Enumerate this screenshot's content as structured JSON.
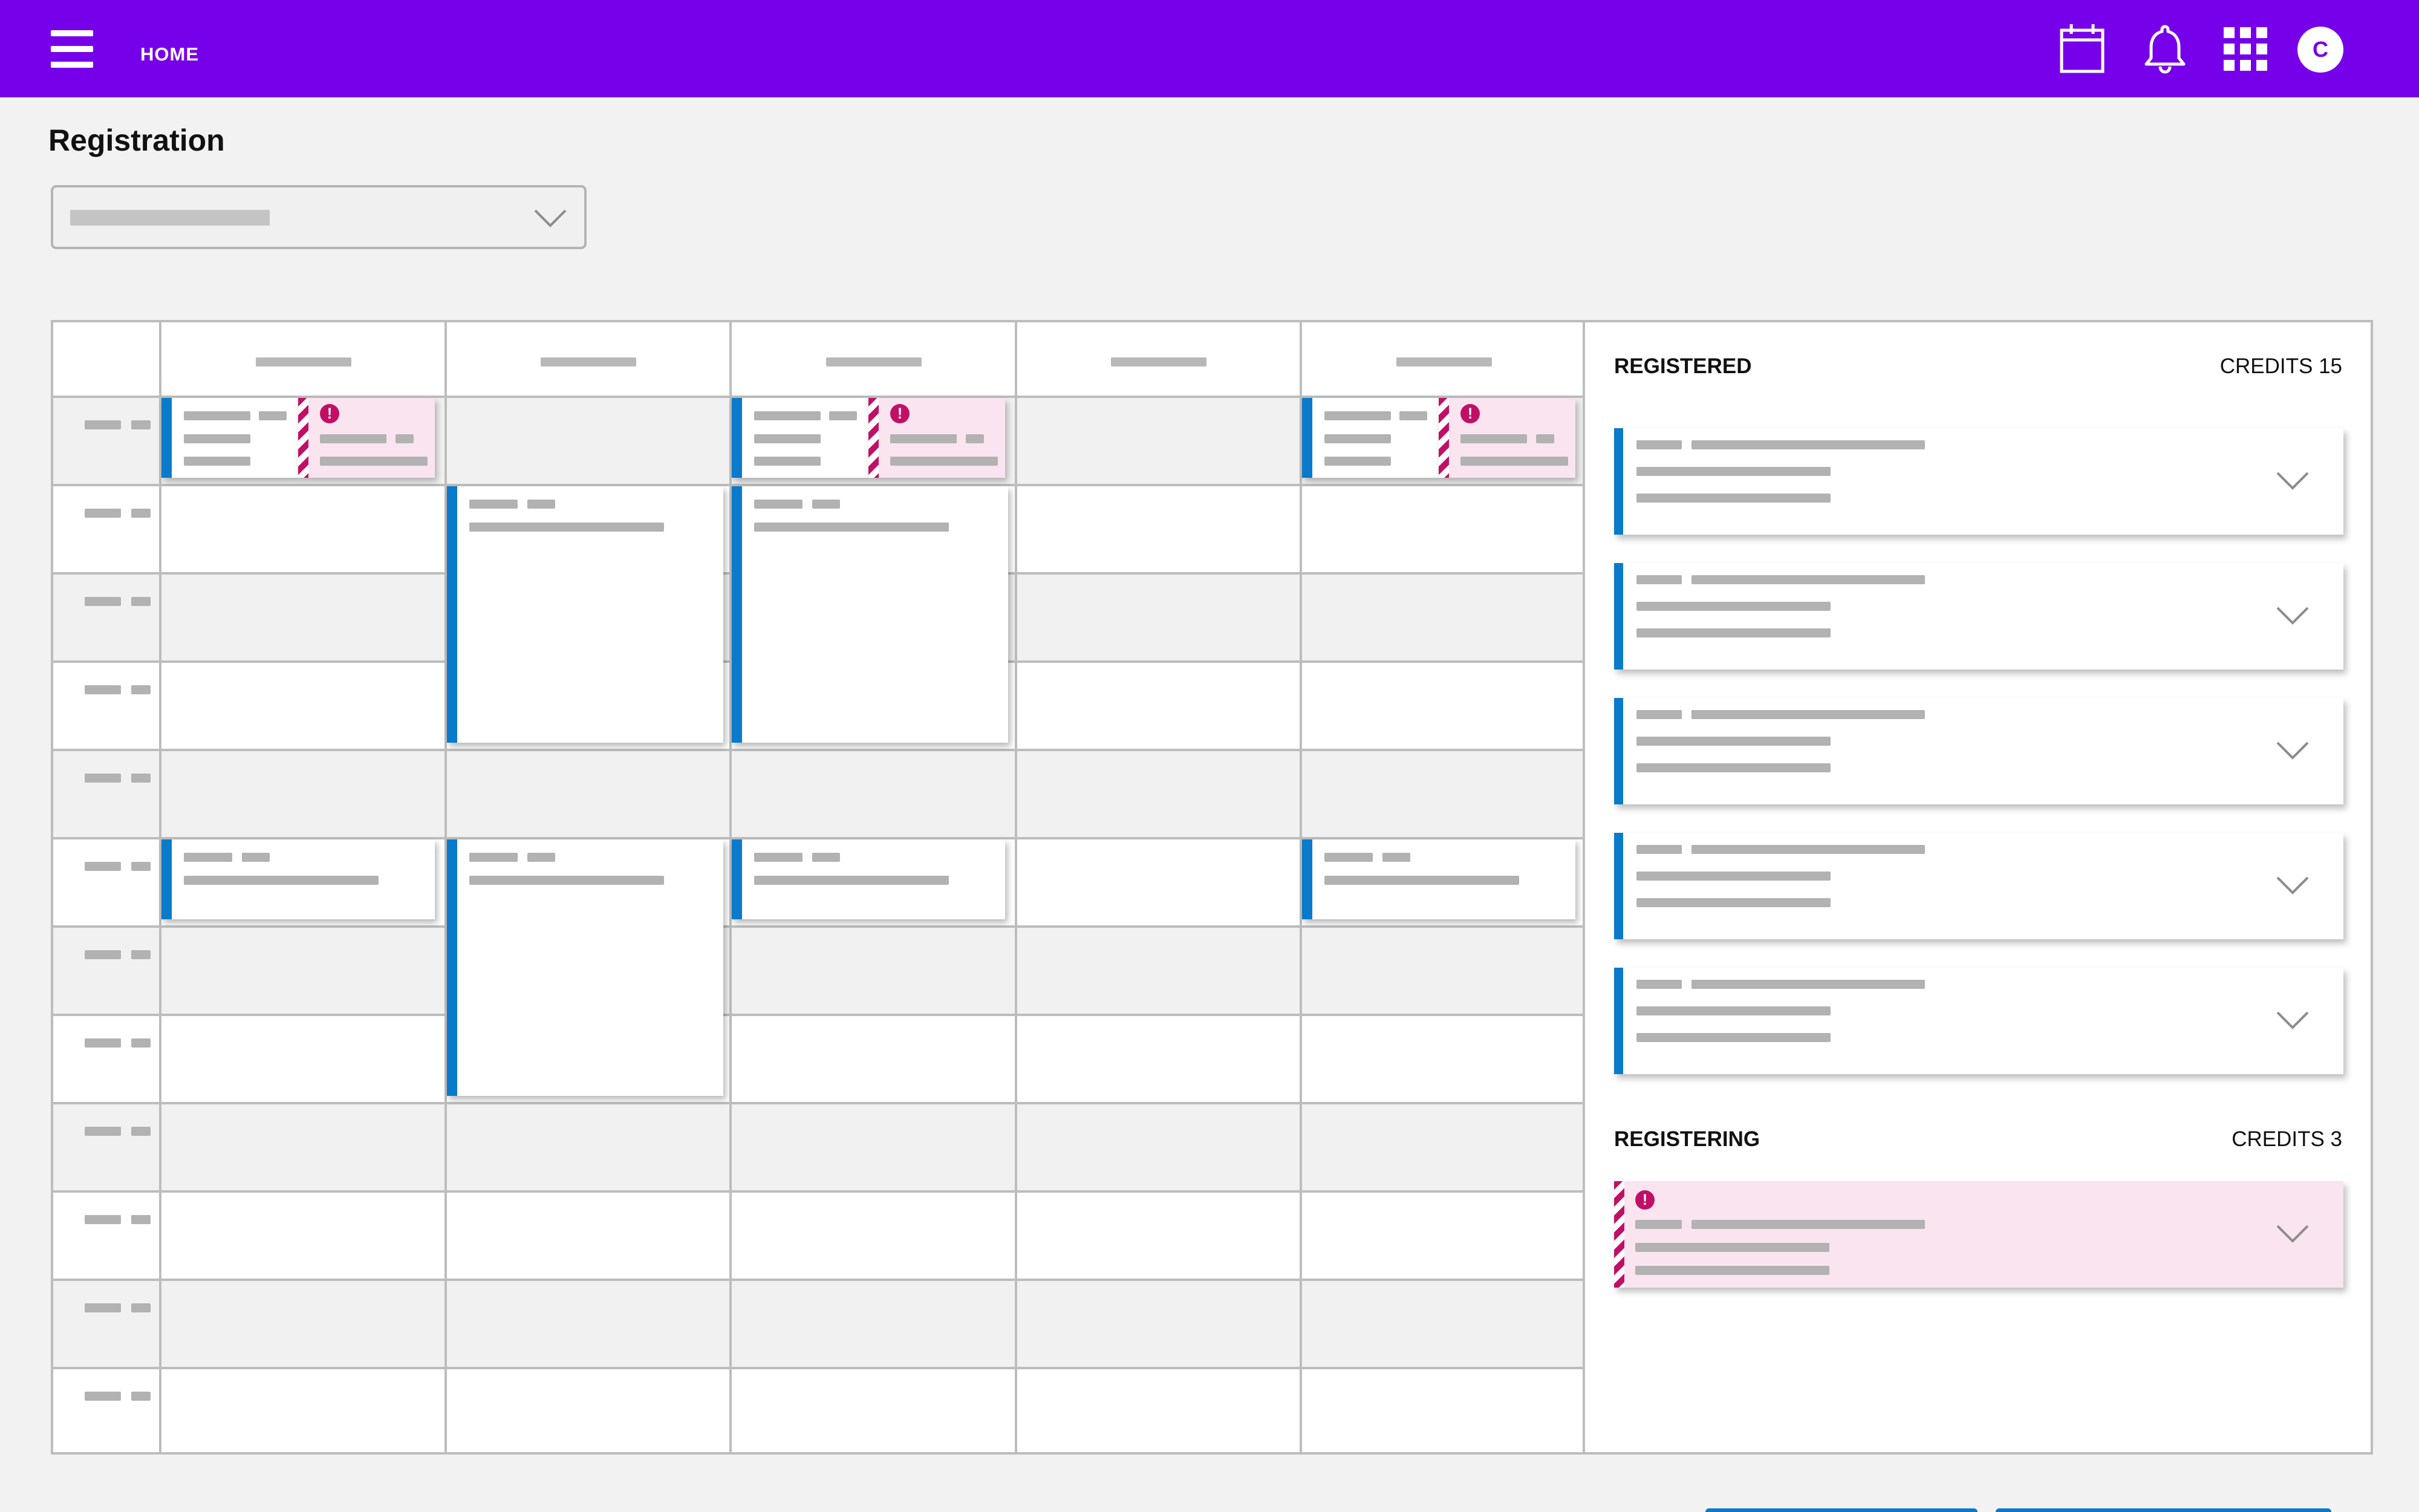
{
  "header": {
    "home_label": "HOME",
    "avatar_initial": "C",
    "background_color": "#7700ea",
    "icons": [
      "menu-icon",
      "calendar-icon",
      "bell-icon",
      "apps-grid-icon"
    ]
  },
  "page": {
    "title": "Registration"
  },
  "term_select": {
    "value": ""
  },
  "schedule": {
    "day_headers": [
      "",
      "",
      "",
      "",
      ""
    ],
    "time_slots": [
      "",
      "",
      "",
      "",
      "",
      "",
      "",
      "",
      "",
      "",
      "",
      ""
    ],
    "accent_color": "#0a7acb",
    "conflict_color": "#c10f66"
  },
  "registered": {
    "title": "REGISTERED",
    "credits": "CREDITS 15",
    "course_count": 5
  },
  "registering": {
    "title": "REGISTERING",
    "credits": "CREDITS 3",
    "course_count": 1,
    "alert_symbol": "!"
  },
  "icons": {
    "chevron": "chevron-down-icon",
    "alert": "alert-icon"
  }
}
